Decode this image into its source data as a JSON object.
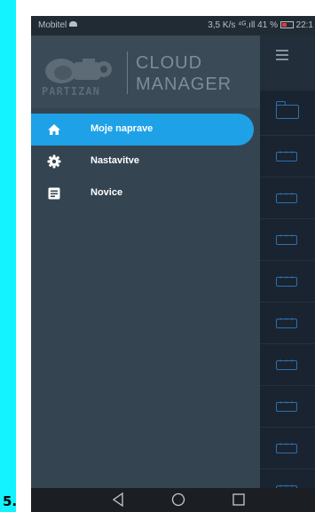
{
  "step_label": "5.",
  "status_bar": {
    "carrier": "Mobitel",
    "right": "3,5 K/s ⁴ᴳ.ıll 41 %",
    "time": "22:1"
  },
  "drawer": {
    "brand_logo_text": "PARTIZAN",
    "brand_line1": "CLOUD",
    "brand_line2": "MANAGER",
    "menu": [
      {
        "label": "Moje naprave",
        "icon": "home-icon",
        "active": true
      },
      {
        "label": "Nastavitve",
        "icon": "gear-icon",
        "active": false
      },
      {
        "label": "Novice",
        "icon": "news-icon",
        "active": false
      }
    ]
  },
  "background_app": {
    "toolbar_icon": "hamburger-menu-icon",
    "rows": [
      "folder-icon",
      "device-icon",
      "device-icon",
      "device-icon",
      "device-icon",
      "device-icon",
      "device-icon",
      "device-icon",
      "device-icon",
      "device-icon"
    ]
  },
  "nav_bar": {
    "buttons": [
      "back-icon",
      "home-circle-icon",
      "recent-apps-icon"
    ]
  },
  "colors": {
    "accent": "#1ea1e6",
    "strip": "#12f3ff",
    "drawer_bg": "#344551",
    "header_bg": "#3a4a56"
  }
}
